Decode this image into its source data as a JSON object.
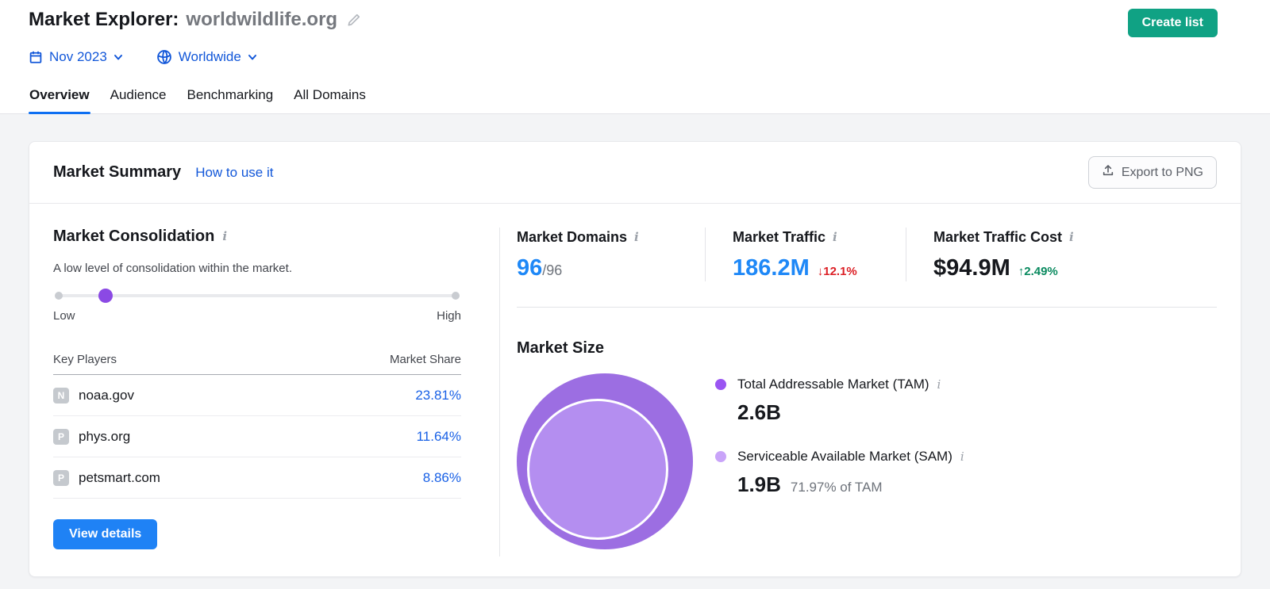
{
  "header": {
    "title_prefix": "Market Explorer:",
    "title_domain": "worldwildlife.org",
    "create_list_label": "Create list",
    "date_filter": "Nov 2023",
    "region_filter": "Worldwide"
  },
  "tabs": [
    {
      "label": "Overview"
    },
    {
      "label": "Audience"
    },
    {
      "label": "Benchmarking"
    },
    {
      "label": "All Domains"
    }
  ],
  "summary_card": {
    "title": "Market Summary",
    "help_link": "How to use it",
    "export_label": "Export to PNG"
  },
  "consolidation": {
    "title": "Market Consolidation",
    "description": "A low level of consolidation within the market.",
    "slider": {
      "low_label": "Low",
      "high_label": "High",
      "level": "low"
    },
    "table": {
      "col_player": "Key Players",
      "col_share": "Market Share",
      "rows": [
        {
          "initial": "N",
          "domain": "noaa.gov",
          "share": "23.81%"
        },
        {
          "initial": "P",
          "domain": "phys.org",
          "share": "11.64%"
        },
        {
          "initial": "P",
          "domain": "petsmart.com",
          "share": "8.86%"
        }
      ]
    },
    "view_details_label": "View details"
  },
  "stats": [
    {
      "label": "Market Domains",
      "value": "96",
      "suffix": "/96"
    },
    {
      "label": "Market Traffic",
      "value": "186.2M",
      "change": "12.1%",
      "direction": "down"
    },
    {
      "label": "Market Traffic Cost",
      "value": "$94.9M",
      "change": "2.49%",
      "direction": "up"
    }
  ],
  "market_size": {
    "title": "Market Size",
    "tam": {
      "label": "Total Addressable Market (TAM)",
      "value": "2.6B"
    },
    "sam": {
      "label": "Serviceable Available Market (SAM)",
      "value": "1.9B",
      "share_of_tam": "71.97% of TAM"
    }
  },
  "icons": {
    "info": "i",
    "arrow_down": "↓",
    "arrow_up": "↑"
  },
  "colors": {
    "accent_blue": "#1e88f7",
    "link_blue": "#1257d9",
    "green": "#10a284",
    "red": "#dc2026",
    "trend_green": "#0a8a5f",
    "purple_thumb": "#8b49e4",
    "tam_circle": "#9c6ee2",
    "sam_circle": "#b48ef0"
  }
}
